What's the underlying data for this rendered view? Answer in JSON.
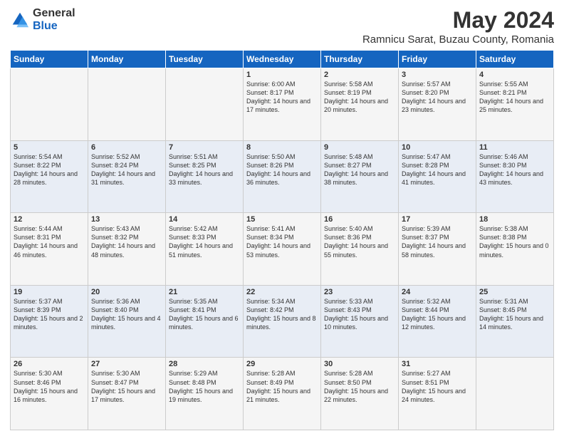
{
  "header": {
    "logo_general": "General",
    "logo_blue": "Blue",
    "main_title": "May 2024",
    "subtitle": "Ramnicu Sarat, Buzau County, Romania"
  },
  "weekdays": [
    "Sunday",
    "Monday",
    "Tuesday",
    "Wednesday",
    "Thursday",
    "Friday",
    "Saturday"
  ],
  "weeks": [
    [
      {
        "day": "",
        "info": ""
      },
      {
        "day": "",
        "info": ""
      },
      {
        "day": "",
        "info": ""
      },
      {
        "day": "1",
        "info": "Sunrise: 6:00 AM\nSunset: 8:17 PM\nDaylight: 14 hours\nand 17 minutes."
      },
      {
        "day": "2",
        "info": "Sunrise: 5:58 AM\nSunset: 8:19 PM\nDaylight: 14 hours\nand 20 minutes."
      },
      {
        "day": "3",
        "info": "Sunrise: 5:57 AM\nSunset: 8:20 PM\nDaylight: 14 hours\nand 23 minutes."
      },
      {
        "day": "4",
        "info": "Sunrise: 5:55 AM\nSunset: 8:21 PM\nDaylight: 14 hours\nand 25 minutes."
      }
    ],
    [
      {
        "day": "5",
        "info": "Sunrise: 5:54 AM\nSunset: 8:22 PM\nDaylight: 14 hours\nand 28 minutes."
      },
      {
        "day": "6",
        "info": "Sunrise: 5:52 AM\nSunset: 8:24 PM\nDaylight: 14 hours\nand 31 minutes."
      },
      {
        "day": "7",
        "info": "Sunrise: 5:51 AM\nSunset: 8:25 PM\nDaylight: 14 hours\nand 33 minutes."
      },
      {
        "day": "8",
        "info": "Sunrise: 5:50 AM\nSunset: 8:26 PM\nDaylight: 14 hours\nand 36 minutes."
      },
      {
        "day": "9",
        "info": "Sunrise: 5:48 AM\nSunset: 8:27 PM\nDaylight: 14 hours\nand 38 minutes."
      },
      {
        "day": "10",
        "info": "Sunrise: 5:47 AM\nSunset: 8:28 PM\nDaylight: 14 hours\nand 41 minutes."
      },
      {
        "day": "11",
        "info": "Sunrise: 5:46 AM\nSunset: 8:30 PM\nDaylight: 14 hours\nand 43 minutes."
      }
    ],
    [
      {
        "day": "12",
        "info": "Sunrise: 5:44 AM\nSunset: 8:31 PM\nDaylight: 14 hours\nand 46 minutes."
      },
      {
        "day": "13",
        "info": "Sunrise: 5:43 AM\nSunset: 8:32 PM\nDaylight: 14 hours\nand 48 minutes."
      },
      {
        "day": "14",
        "info": "Sunrise: 5:42 AM\nSunset: 8:33 PM\nDaylight: 14 hours\nand 51 minutes."
      },
      {
        "day": "15",
        "info": "Sunrise: 5:41 AM\nSunset: 8:34 PM\nDaylight: 14 hours\nand 53 minutes."
      },
      {
        "day": "16",
        "info": "Sunrise: 5:40 AM\nSunset: 8:36 PM\nDaylight: 14 hours\nand 55 minutes."
      },
      {
        "day": "17",
        "info": "Sunrise: 5:39 AM\nSunset: 8:37 PM\nDaylight: 14 hours\nand 58 minutes."
      },
      {
        "day": "18",
        "info": "Sunrise: 5:38 AM\nSunset: 8:38 PM\nDaylight: 15 hours\nand 0 minutes."
      }
    ],
    [
      {
        "day": "19",
        "info": "Sunrise: 5:37 AM\nSunset: 8:39 PM\nDaylight: 15 hours\nand 2 minutes."
      },
      {
        "day": "20",
        "info": "Sunrise: 5:36 AM\nSunset: 8:40 PM\nDaylight: 15 hours\nand 4 minutes."
      },
      {
        "day": "21",
        "info": "Sunrise: 5:35 AM\nSunset: 8:41 PM\nDaylight: 15 hours\nand 6 minutes."
      },
      {
        "day": "22",
        "info": "Sunrise: 5:34 AM\nSunset: 8:42 PM\nDaylight: 15 hours\nand 8 minutes."
      },
      {
        "day": "23",
        "info": "Sunrise: 5:33 AM\nSunset: 8:43 PM\nDaylight: 15 hours\nand 10 minutes."
      },
      {
        "day": "24",
        "info": "Sunrise: 5:32 AM\nSunset: 8:44 PM\nDaylight: 15 hours\nand 12 minutes."
      },
      {
        "day": "25",
        "info": "Sunrise: 5:31 AM\nSunset: 8:45 PM\nDaylight: 15 hours\nand 14 minutes."
      }
    ],
    [
      {
        "day": "26",
        "info": "Sunrise: 5:30 AM\nSunset: 8:46 PM\nDaylight: 15 hours\nand 16 minutes."
      },
      {
        "day": "27",
        "info": "Sunrise: 5:30 AM\nSunset: 8:47 PM\nDaylight: 15 hours\nand 17 minutes."
      },
      {
        "day": "28",
        "info": "Sunrise: 5:29 AM\nSunset: 8:48 PM\nDaylight: 15 hours\nand 19 minutes."
      },
      {
        "day": "29",
        "info": "Sunrise: 5:28 AM\nSunset: 8:49 PM\nDaylight: 15 hours\nand 21 minutes."
      },
      {
        "day": "30",
        "info": "Sunrise: 5:28 AM\nSunset: 8:50 PM\nDaylight: 15 hours\nand 22 minutes."
      },
      {
        "day": "31",
        "info": "Sunrise: 5:27 AM\nSunset: 8:51 PM\nDaylight: 15 hours\nand 24 minutes."
      },
      {
        "day": "",
        "info": ""
      }
    ]
  ]
}
